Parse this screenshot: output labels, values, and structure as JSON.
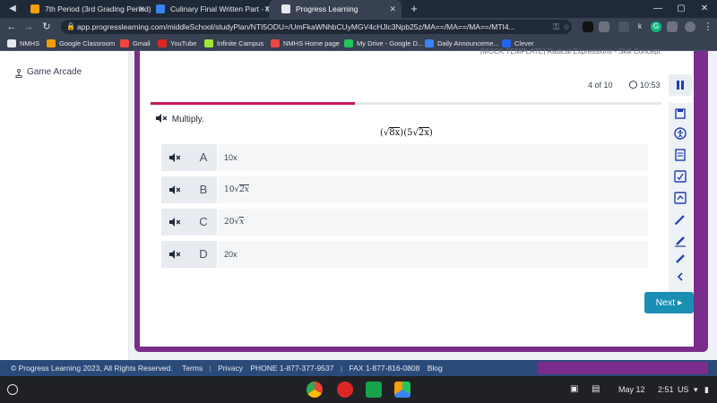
{
  "browser": {
    "tabs": [
      {
        "title": "7th Period (3rd Grading Period)",
        "active": false
      },
      {
        "title": "Culinary Final Written Part - Goo",
        "active": false
      },
      {
        "title": "Progress Learning",
        "active": true
      }
    ],
    "new_tab": "+",
    "url": "app.progresslearning.com/middleSchool/studyPlan/NTI5ODU=/UmFkaWNhbCUyMGV4cHJlc3Npb25z/MA==/MA==/MA==/MTI4...",
    "extensions": [
      "k",
      "G"
    ],
    "bookmarks": [
      "NMHS",
      "Google Classroom",
      "Gmail",
      "YouTube",
      "Infinite Campus",
      "NMHS Home page",
      "My Drive - Google D...",
      "Daily Announceme...",
      "Clever"
    ]
  },
  "sidebar": {
    "game_arcade": "Game Arcade"
  },
  "quiz": {
    "title_strip": "[MOCK TEMPLATE] Radical Expressions - Skill Concept",
    "counter": "4 of 10",
    "timer": "10:53",
    "progress": 0.4,
    "prompt": "Multiply.",
    "expression": {
      "open": "(√",
      "r1": "8x",
      "mid": ")(5√",
      "r2": "2x",
      "close": ")"
    },
    "answers": [
      {
        "letter": "A",
        "coef": "10x",
        "radicand": ""
      },
      {
        "letter": "B",
        "coef": "10",
        "radicand": "2x"
      },
      {
        "letter": "C",
        "coef": "20",
        "radicand": "x"
      },
      {
        "letter": "D",
        "coef": "20x",
        "radicand": ""
      }
    ],
    "next_label": "Next"
  },
  "footer": {
    "copyright": "© Progress Learning 2023, All Rights Reserved.",
    "terms": "Terms",
    "privacy": "Privacy",
    "phone": "PHONE 1-877-377-9537",
    "fax": "FAX 1-877-816-0808",
    "blog": "Blog"
  },
  "shelf": {
    "date": "May 12",
    "time": "2:51",
    "locale": "US"
  }
}
